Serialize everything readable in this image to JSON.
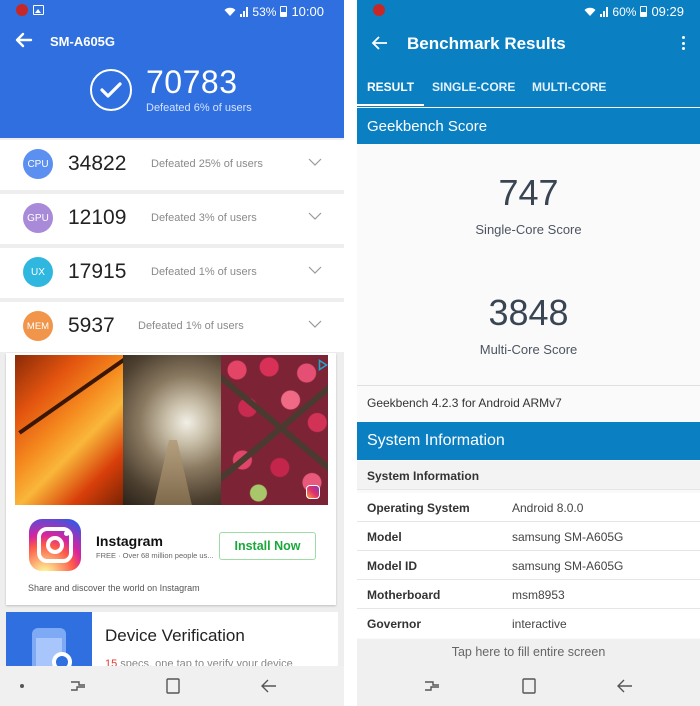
{
  "left_screen": {
    "status_bar": {
      "battery": "53%",
      "time": "10:00",
      "notification_icons": [
        "bug-icon",
        "image-icon"
      ],
      "system_icons": [
        "wifi-icon",
        "signal-icon",
        "battery-icon"
      ]
    },
    "toolbar": {
      "back_icon": "arrow-left-icon",
      "title": "SM-A605G"
    },
    "total": {
      "icon": "check-circle-icon",
      "score": "70783",
      "subtitle": "Defeated 6% of users"
    },
    "scores": [
      {
        "badge": "CPU",
        "score": "34822",
        "subtitle": "Defeated 25% of users",
        "color": "#5b8ff0"
      },
      {
        "badge": "GPU",
        "score": "12109",
        "subtitle": "Defeated 3% of users",
        "color": "#a88ad9"
      },
      {
        "badge": "UX",
        "score": "17915",
        "subtitle": "Defeated 1% of users",
        "color": "#2fb7e0"
      },
      {
        "badge": "MEM",
        "score": "5937",
        "subtitle": "Defeated 1% of users",
        "color": "#f0954a"
      }
    ],
    "ad": {
      "app_name": "Instagram",
      "description": "FREE · Over 68 million people us...",
      "cta": "Install Now",
      "tagline": "Share and discover the world on Instagram",
      "icons": [
        "instagram-logo-icon",
        "adchoices-icon"
      ]
    },
    "device_verification": {
      "title": "Device Verification",
      "sub_number": "15",
      "sub_text": " specs, one tap to verify your device"
    },
    "navbar": [
      "dot-icon",
      "recents-icon",
      "home-icon",
      "back-icon"
    ]
  },
  "right_screen": {
    "status_bar": {
      "battery": "60%",
      "time": "09:29",
      "notification_icons": [
        "bug-icon"
      ],
      "system_icons": [
        "wifi-icon",
        "signal-icon",
        "battery-icon"
      ]
    },
    "toolbar": {
      "back_icon": "arrow-left-icon",
      "title": "Benchmark Results",
      "menu_icon": "more-vert-icon"
    },
    "tabs": [
      {
        "label": "RESULT",
        "active": true
      },
      {
        "label": "SINGLE-CORE",
        "active": false
      },
      {
        "label": "MULTI-CORE",
        "active": false
      }
    ],
    "geekbench_score": {
      "header": "Geekbench Score",
      "single_core": {
        "score": "747",
        "label": "Single-Core Score"
      },
      "multi_core": {
        "score": "3848",
        "label": "Multi-Core Score"
      },
      "version": "Geekbench 4.2.3 for Android ARMv7"
    },
    "system_information": {
      "header": "System Information",
      "subheader": "System Information",
      "rows": [
        {
          "key": "Operating System",
          "value": "Android 8.0.0"
        },
        {
          "key": "Model",
          "value": "samsung SM-A605G"
        },
        {
          "key": "Model ID",
          "value": "samsung SM-A605G"
        },
        {
          "key": "Motherboard",
          "value": "msm8953"
        },
        {
          "key": "Governor",
          "value": "interactive"
        }
      ]
    },
    "fill_screen_hint": "Tap here to fill entire screen",
    "navbar": [
      "recents-icon",
      "home-icon",
      "back-icon"
    ]
  },
  "colors": {
    "antutu_blue": "#2f6fe0",
    "geekbench_blue": "#0a7fc2",
    "install_green": "#19a93a"
  }
}
